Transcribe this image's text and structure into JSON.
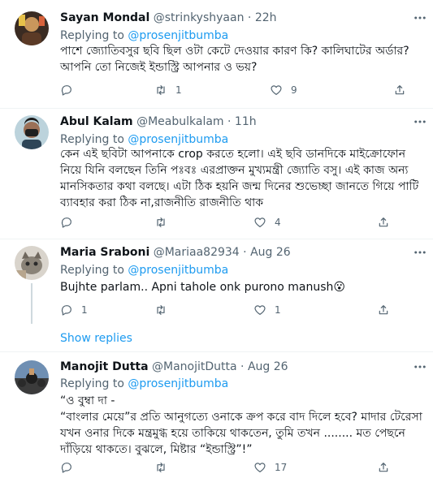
{
  "tweets": [
    {
      "name": "Sayan Mondal",
      "handle": "@strinkyshyaan",
      "dot": "·",
      "time": "22h",
      "reply_prefix": "Replying to",
      "reply_to": "@prosenjitbumba",
      "lines": [
        "পাশে জ্যোতিবসুর ছবি ছিল ওটা কেটে দেওয়ার কারণ কি? কালিঘাটের অর্ডার?",
        "আপনি তো নিজেই ইন্ডাস্ট্রি আপনার ও ভয়?"
      ],
      "counts": {
        "reply": "",
        "retweet": "1",
        "like": "9"
      }
    },
    {
      "name": "Abul Kalam",
      "handle": "@Meabulkalam",
      "dot": "·",
      "time": "11h",
      "reply_prefix": "Replying to",
      "reply_to": "@prosenjitbumba",
      "lines": [
        "কেন এই ছবিটা আপনাকে crop করতে হলো। এই ছবি ডানদিকে মাইক্রোফোন",
        "নিয়ে যিনি বলছেন তিনি পঃবঃ এরপ্রাক্তন মুখ্যমন্ত্রী জ্যোতি বসু। এই কাজ অন্য",
        "মানসিকতার কথা বলছে। এটা ঠিক হয়নি জন্ম দিনের শুভেচ্ছা জানতে গিয়ে পাটি",
        "ব্যাবহার করা ঠিক না,রাজনীতি রাজনীতি  থাক"
      ],
      "counts": {
        "reply": "",
        "retweet": "",
        "like": "4"
      }
    },
    {
      "name": "Maria Sraboni",
      "handle": "@Mariaa82934",
      "dot": "·",
      "time": "Aug 26",
      "reply_prefix": "Replying to",
      "reply_to": "@prosenjitbumba",
      "lines": [
        "Bujhte parlam.. Apni tahole onk purono manush😮"
      ],
      "counts": {
        "reply": "1",
        "retweet": "",
        "like": "1"
      }
    },
    {
      "name": "Manojit Dutta",
      "handle": "@ManojitDutta",
      "dot": "·",
      "time": "Aug 26",
      "reply_prefix": "Replying to",
      "reply_to": "@prosenjitbumba",
      "lines": [
        "“ও বুম্বা দা -",
        "“বাংলার মেয়ে”র প্রতি আনুগত্যে ওনাকে ক্রপ করে বাদ দিলে হবে? মাদার টেরেসা",
        "যখন ওনার দিকে মন্ত্রমুগ্ধ হয়ে তাকিয়ে থাকতেন, তুমি তখন ........   মত পেছনে",
        "দাঁড়িয়ে থাকতে। বুঝলে, মিষ্টার “ইন্ডাস্ট্রি”!”"
      ],
      "counts": {
        "reply": "",
        "retweet": "",
        "like": "17"
      }
    }
  ],
  "show_replies": "Show replies",
  "icons": {
    "more": "more-horizontal-icon",
    "reply": "reply-bubble-icon",
    "retweet": "retweet-icon",
    "like": "heart-icon",
    "share": "share-icon"
  },
  "colors": {
    "link": "#1d9bf0",
    "muted": "#536471",
    "text": "#0f1419",
    "divider": "#eff3f4"
  }
}
